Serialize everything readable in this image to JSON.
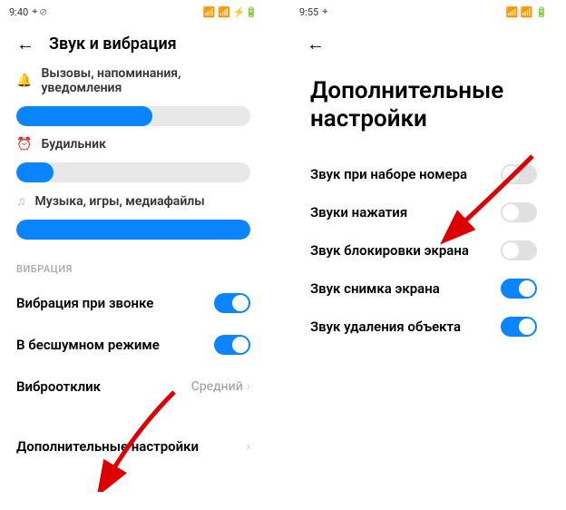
{
  "left": {
    "status": {
      "time": "9:40",
      "icons_right": "📶 📶 ⚡🔋"
    },
    "title": "Звук и вибрация",
    "sliders": [
      {
        "icon": "🔔",
        "label": "Вызовы, напоминания, уведомления",
        "fill": 58
      },
      {
        "icon": "⏰",
        "label": "Будильник",
        "fill": 16
      },
      {
        "icon": "♫",
        "label": "Музыка, игры, медиафайлы",
        "fill": 100
      }
    ],
    "section_label": "ВИБРАЦИЯ",
    "toggles": [
      {
        "label": "Вибрация при звонке",
        "on": true
      },
      {
        "label": "В бесшумном режиме",
        "on": true
      }
    ],
    "nav_feedback": {
      "label": "Виброотклик",
      "value": "Средний"
    },
    "nav_additional": {
      "label": "Дополнительные настройки"
    }
  },
  "right": {
    "status": {
      "time": "9:55",
      "icons_right": "📶 📶 🔋"
    },
    "title": "Дополнительные настройки",
    "toggles": [
      {
        "label": "Звук при наборе номера",
        "on": false
      },
      {
        "label": "Звуки нажатия",
        "on": false
      },
      {
        "label": "Звук блокировки экрана",
        "on": false
      },
      {
        "label": "Звук снимка экрана",
        "on": true
      },
      {
        "label": "Звук удаления объекта",
        "on": true
      }
    ]
  }
}
